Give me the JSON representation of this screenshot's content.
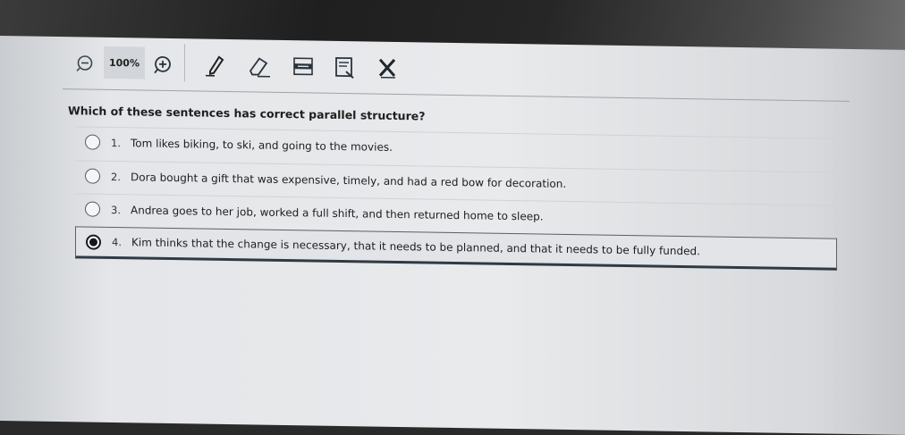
{
  "toolbar": {
    "zoom_level": "100%",
    "icons": [
      "zoom-out-icon",
      "zoom-in-icon",
      "pencil-icon",
      "eraser-icon",
      "line-reader-icon",
      "notepad-icon",
      "answer-eliminator-icon"
    ]
  },
  "question": {
    "text": "Which of these sentences has correct parallel structure?"
  },
  "answers": [
    {
      "number": "1.",
      "text": "Tom likes biking, to ski, and going to the movies.",
      "selected": false
    },
    {
      "number": "2.",
      "text": "Dora bought a gift that was expensive, timely, and had a red bow for decoration.",
      "selected": false
    },
    {
      "number": "3.",
      "text": "Andrea goes to her job, worked a full shift, and then returned home to sleep.",
      "selected": false
    },
    {
      "number": "4.",
      "text": "Kim thinks that the change is necessary, that it needs to be planned, and that it needs to be fully funded.",
      "selected": true
    }
  ],
  "colors": {
    "accent": "#2f3a44",
    "page_bg": "#e6e8ea"
  }
}
